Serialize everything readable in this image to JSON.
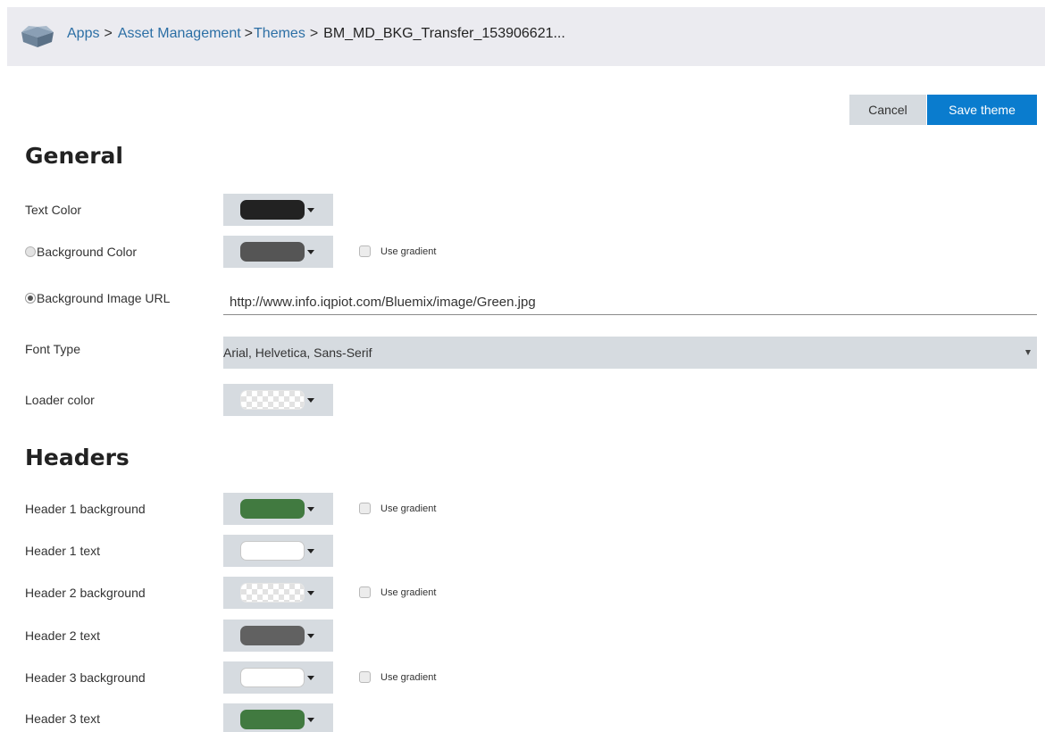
{
  "breadcrumb": {
    "icon": "app-box-icon",
    "items": [
      "Apps",
      "Asset Management",
      "Themes"
    ],
    "separator": ">",
    "current": "BM_MD_BKG_Transfer_153906621..."
  },
  "actions": {
    "cancel_label": "Cancel",
    "save_label": "Save theme"
  },
  "general": {
    "title": "General",
    "text_color": {
      "label": "Text Color",
      "color": "#222222"
    },
    "background_color": {
      "label": "Background Color",
      "color": "#555555",
      "selected": false,
      "gradient_label": "Use gradient",
      "gradient_checked": false
    },
    "background_image": {
      "label": "Background Image URL",
      "selected": true,
      "value": "http://www.info.iqpiot.com/Bluemix/image/Green.jpg"
    },
    "font_type": {
      "label": "Font Type",
      "value": "Arial, Helvetica, Sans-Serif"
    },
    "loader_color": {
      "label": "Loader color",
      "color": "transparent"
    }
  },
  "headers": {
    "title": "Headers",
    "items": [
      {
        "label": "Header 1 background",
        "color": "#417a40",
        "gradient": true,
        "gradient_label": "Use gradient"
      },
      {
        "label": "Header 1 text",
        "color": "#ffffff",
        "gradient": false
      },
      {
        "label": "Header 2 background",
        "color": "transparent",
        "gradient": true,
        "gradient_label": "Use gradient"
      },
      {
        "label": "Header 2 text",
        "color": "#616161",
        "gradient": false
      },
      {
        "label": "Header 3 background",
        "color": "#ffffff",
        "gradient": true,
        "gradient_label": "Use gradient"
      },
      {
        "label": "Header 3 text",
        "color": "#417a40",
        "gradient": false
      }
    ]
  }
}
